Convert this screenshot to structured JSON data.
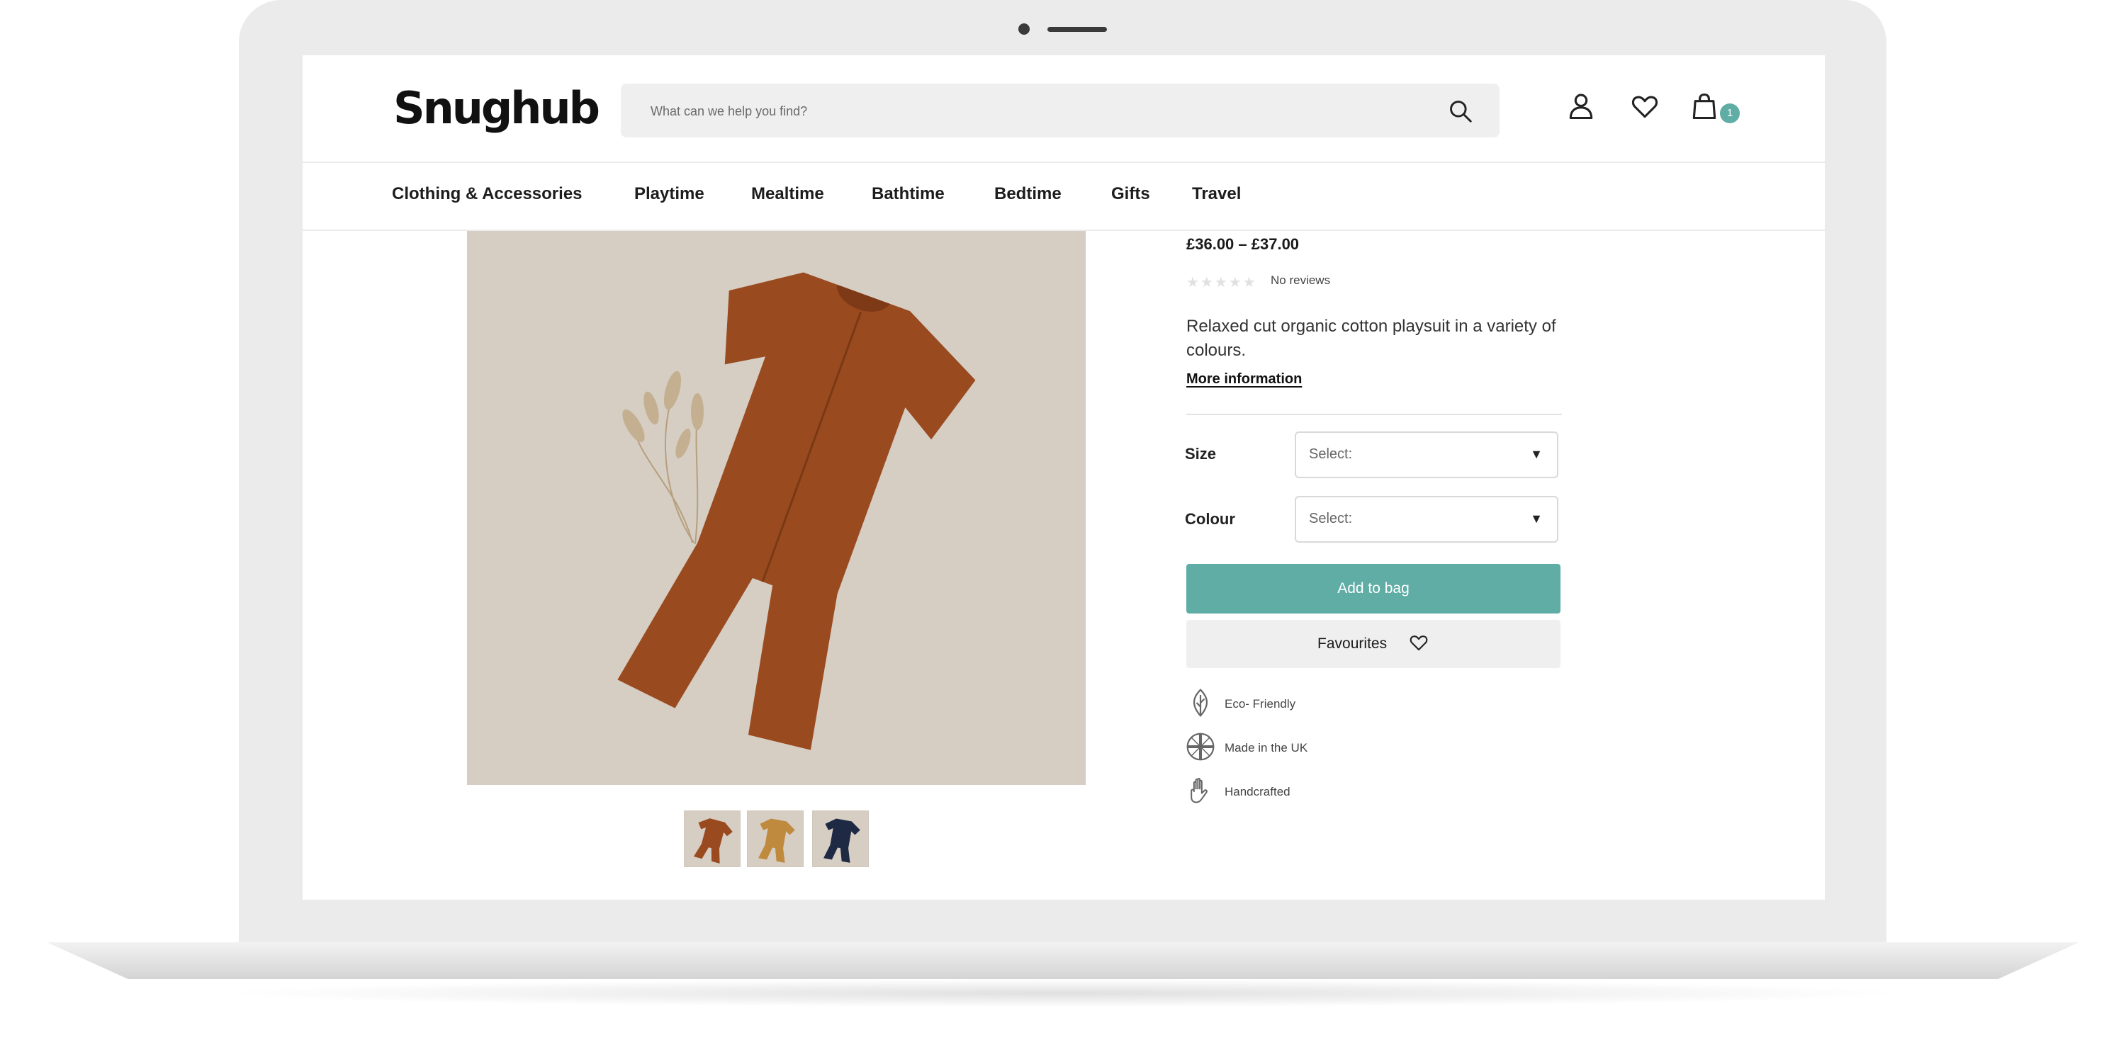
{
  "header": {
    "logo": "Snughub",
    "search_placeholder": "What can we help you find?",
    "bag_count": "1"
  },
  "nav": {
    "items": [
      "Clothing & Accessories",
      "Playtime",
      "Mealtime",
      "Bathtime",
      "Bedtime",
      "Gifts",
      "Travel"
    ]
  },
  "product": {
    "price": "£36.00 – £37.00",
    "rating_stars": "★★★★★",
    "reviews_label": "No reviews",
    "description": "Relaxed cut organic cotton playsuit in a variety of colours.",
    "more_info": "More information",
    "image_color": "#9a4a1f",
    "thumbnails": [
      {
        "color": "#9a4a1f"
      },
      {
        "color": "#c08a3e"
      },
      {
        "color": "#1e2a44"
      }
    ]
  },
  "options": {
    "size_label": "Size",
    "size_value": "Select:",
    "colour_label": "Colour",
    "colour_value": "Select:"
  },
  "actions": {
    "add_to_bag": "Add to bag",
    "favourites": "Favourites"
  },
  "features": [
    {
      "icon": "leaf-icon",
      "label": "Eco- Friendly"
    },
    {
      "icon": "uk-flag-icon",
      "label": "Made in the UK"
    },
    {
      "icon": "hand-icon",
      "label": "Handcrafted"
    }
  ],
  "colors": {
    "accent": "#5fada5",
    "image_bg": "#d6cdc3"
  }
}
